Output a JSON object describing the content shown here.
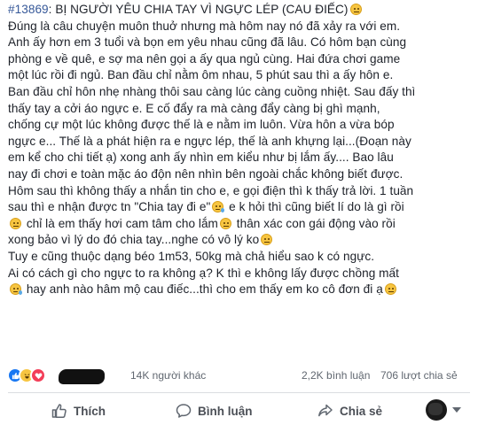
{
  "post": {
    "hashtag": "#13869",
    "lines": [
      ": BỊ NGƯỜI YÊU CHIA TAY VÌ NGỰC LÉP (CAU ĐIẾC)",
      "Đúng là câu chuyện muôn thuở nhưng mà hôm nay nó đã xảy ra với em.",
      "Anh ấy hơn em 3 tuổi và bọn em yêu nhau cũng đã lâu. Có hôm bạn cùng",
      "phòng e về quê, e sợ ma nên gọi a ấy qua ngủ cùng. Hai đứa chơi game",
      "một lúc rồi đi ngủ. Ban đầu chỉ nằm ôm nhau, 5 phút sau thì a ấy hôn e.",
      "Ban đầu chỉ hôn nhẹ nhàng thôi sau càng lúc càng cuồng nhiệt. Sau đấy thì",
      "thấy tay a cởi áo ngực e. E cố đẩy ra mà càng đẩy càng bị ghì mạnh,",
      "chống cự một lúc không được thế là e nằm im luôn. Vừa hôn a vừa bóp",
      "ngực e... Thế là a phát hiện ra e ngực lép, thế là anh khựng lại...(Đoạn này",
      "em kể cho chi tiết ạ) xong anh ấy nhìn em kiểu như bị lắm ấy.... Bao lâu",
      "nay đi chơi e toàn mặc áo độn nên nhìn bên ngoài chắc không biết được.",
      "Hôm sau thì không thấy a nhắn tin cho e, e gọi điện thì k thấy trả lời. 1 tuần",
      "sau thì e nhận được tn \"Chia tay đi e\"",
      " e k hỏi thì cũng biết lí do là gì rồi",
      " chỉ là em thấy hơi cam tâm cho lắm",
      " thân xác con gái động vào rồi",
      "xong bảo vì lý do đó chia tay...nghe có vô lý ko",
      "Tuy e cũng thuộc dạng béo 1m53, 50kg mà chả hiểu sao k có ngực.",
      "Ai có cách gì cho ngực to ra không ạ? K thì e không lấy được chồng mất",
      " hay anh nào hâm mộ cau điếc...thì cho em thấy em ko cô đơn đi ạ"
    ]
  },
  "reactions": {
    "others_text": "14K người khác",
    "comments_text": "2,2K bình luận",
    "shares_text": "706 lượt chia sẻ"
  },
  "actions": {
    "like_label": "Thích",
    "comment_label": "Bình luận",
    "share_label": "Chia sẻ"
  },
  "colors": {
    "hashtag": "#365899",
    "like_blue": "#1877f2",
    "love_red": "#f33e58",
    "haha_yellow": "#f7c541"
  }
}
